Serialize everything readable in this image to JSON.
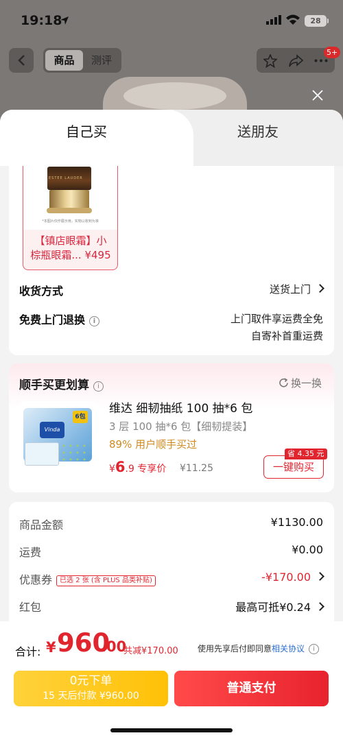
{
  "status_bar": {
    "time": "19:18",
    "battery": "28"
  },
  "nav": {
    "tab_product": "商品",
    "tab_review": "测评",
    "badge": "5+"
  },
  "tabs": {
    "self": "自己买",
    "gift": "送朋友"
  },
  "product": {
    "name_line1": "【镇店眼霜】小",
    "name_line2": "棕瓶眼霜...",
    "price": "¥495",
    "caption": "*本图片仅作展示用，实物以收到为准"
  },
  "delivery": {
    "label": "收货方式",
    "value": "送货上门"
  },
  "returns": {
    "label": "免费上门退换",
    "info": "i",
    "line1": "上门取件享运费全免",
    "line2": "自寄补首重运费"
  },
  "upsell": {
    "title": "顺手买更划算",
    "swap": "换一换",
    "name": "维达 细韧抽纸 100 抽*6 包",
    "spec": "3 层 100 抽*6 包【细韧提装】",
    "buyers": "89% 用户顺手买过",
    "price_cur": "¥",
    "price_int": "6",
    "price_dec": ".9",
    "price_label": "专享价",
    "orig_price": "¥11.25",
    "save_tag": "省 4.35 元",
    "buy_button": "一键购买",
    "brand": "Vinda",
    "pack_count": "6包"
  },
  "summary": {
    "goods_label": "商品金额",
    "goods_value": "¥1130.00",
    "shipping_label": "运费",
    "shipping_value": "¥0.00",
    "coupon_label": "优惠券",
    "coupon_tag": "已选 2 张 (含 PLUS 品类补贴)",
    "coupon_value": "-¥170.00",
    "redpacket_label": "红包",
    "redpacket_value": "最高可抵¥0.24"
  },
  "footer": {
    "total_label": "合计:",
    "total_cur": "¥",
    "total_int": "960",
    "total_dec": ".00",
    "total_save": "共减¥170.00",
    "agree_text": "使用先享后付即同意",
    "agree_link": "相关协议",
    "later_line1": "0元下单",
    "later_line2": "15 天后付款 ¥960.00",
    "pay_button": "普通支付"
  },
  "colors": {
    "accent_red": "#e0252f",
    "later_yellow": "#ffc107",
    "link_blue": "#2b6fd6"
  }
}
